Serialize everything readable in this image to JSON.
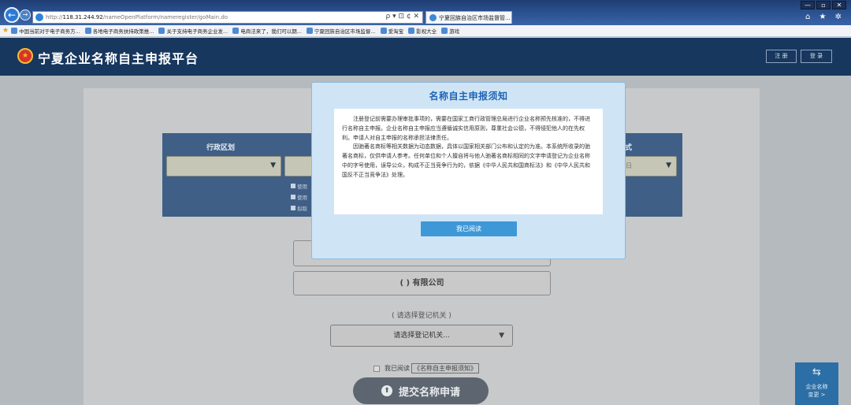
{
  "browser": {
    "address_scheme": "http://",
    "address_host": "118.31.244.92",
    "address_path": "/nameOpenPlatform/nameregister/goMain.do",
    "address_tools": "ρ ▾ ⊡ ¢ ✕",
    "tab_title": "宁夏回族自治区市场监督管...",
    "tab_close": "×",
    "chrome_icons": "⌂ ★ ✲",
    "window_controls": [
      "—",
      "▫",
      "✕"
    ],
    "favorites": [
      "中国当前对于电子商务方...",
      "各地电子商务扶持政策推...",
      "关于支持电子商务企业发...",
      "电商法来了，我们可以期...",
      "宁夏回族自治区市场监督...",
      "爱淘宝",
      "影视大全",
      "游戏"
    ]
  },
  "header": {
    "site_title": "宁夏企业名称自主申报平台",
    "register_label": "注 册",
    "login_label": "登 录"
  },
  "form": {
    "region_label": "行政区划",
    "org_form_label_partial": "式",
    "org_form_placeholder_partial": "日",
    "checkbox_options": [
      "使用",
      "使用",
      "拟取"
    ],
    "company_suffix": "( ) 有限公司",
    "registry_label": "( 请选择登记机关 )",
    "registry_placeholder": "请选择登记机关...",
    "agree_text": "我已阅读",
    "agree_link": "《名称自主申报须知》",
    "submit_label": "提交名称申请"
  },
  "side_widget": {
    "line1": "企业名称",
    "line2": "变更 >"
  },
  "modal": {
    "title": "名称自主申报须知",
    "paragraph1": "注册登记前需要办理审批事项的，需要在国家工商行政管理总局进行企业名称预先核准的，不得进行名称自主申报。企业名称自主申报应当遵循诚实信用原则，尊重社会公德，不得侵犯他人的在先权利。申请人对自主申报的名称承担法律责任。",
    "paragraph2": "因驰著名商标等相关数据为动态数据，具体以国家相关部门公布和认定的为准。本系统所收录的驰著名商标，仅供申请人参考。任何单位和个人擅自将与他人驰著名商标相同的文字申请登记为企业名称中的字号使用，误导公众，构成不正当竞争行为的，依据《中华人民共和国商标法》和《中华人民共和国反不正当竞争法》处理。",
    "button_label": "我已阅读"
  }
}
